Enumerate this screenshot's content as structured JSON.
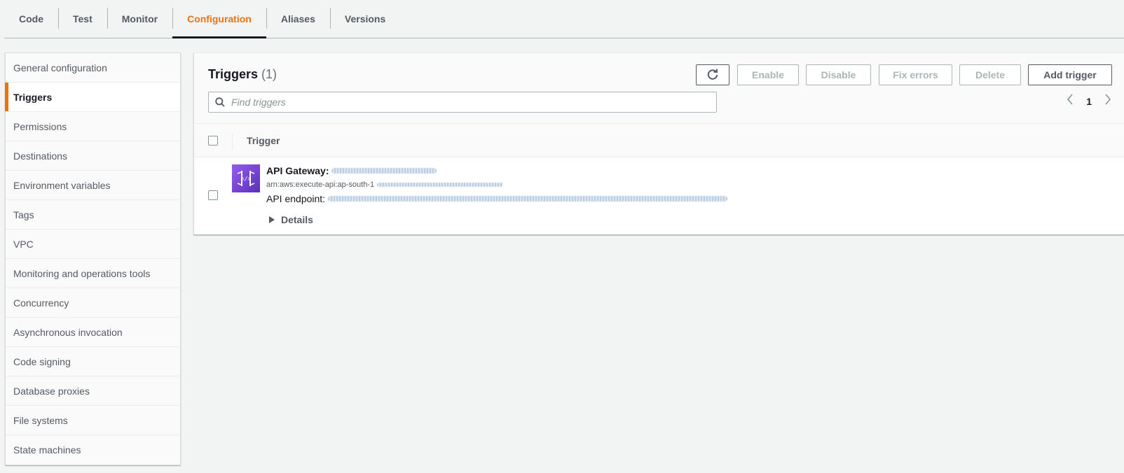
{
  "tabs": [
    {
      "label": "Code",
      "active": false
    },
    {
      "label": "Test",
      "active": false
    },
    {
      "label": "Monitor",
      "active": false
    },
    {
      "label": "Configuration",
      "active": true
    },
    {
      "label": "Aliases",
      "active": false
    },
    {
      "label": "Versions",
      "active": false
    }
  ],
  "sidebar": {
    "items": [
      {
        "label": "General configuration"
      },
      {
        "label": "Triggers",
        "active": true
      },
      {
        "label": "Permissions"
      },
      {
        "label": "Destinations"
      },
      {
        "label": "Environment variables"
      },
      {
        "label": "Tags"
      },
      {
        "label": "VPC"
      },
      {
        "label": "Monitoring and operations tools"
      },
      {
        "label": "Concurrency"
      },
      {
        "label": "Asynchronous invocation"
      },
      {
        "label": "Code signing"
      },
      {
        "label": "Database proxies"
      },
      {
        "label": "File systems"
      },
      {
        "label": "State machines"
      }
    ]
  },
  "triggers": {
    "title": "Triggers",
    "count": "(1)",
    "buttons": {
      "enable": "Enable",
      "disable": "Disable",
      "fix_errors": "Fix errors",
      "delete": "Delete",
      "add_trigger": "Add trigger"
    },
    "search": {
      "placeholder": "Find triggers",
      "value": ""
    },
    "pager": {
      "page": "1"
    },
    "table": {
      "column_header": "Trigger",
      "rows": [
        {
          "name_label": "API Gateway:",
          "arn_prefix": "arn:aws:execute-api:ap-south-1",
          "endpoint_label": "API endpoint:",
          "details_label": "Details"
        }
      ]
    }
  },
  "colors": {
    "accent": "#ec7211",
    "api_gateway_icon": "#7b44d9",
    "text_primary": "#16191f",
    "text_secondary": "#545b64",
    "disabled": "#aab7b8"
  }
}
